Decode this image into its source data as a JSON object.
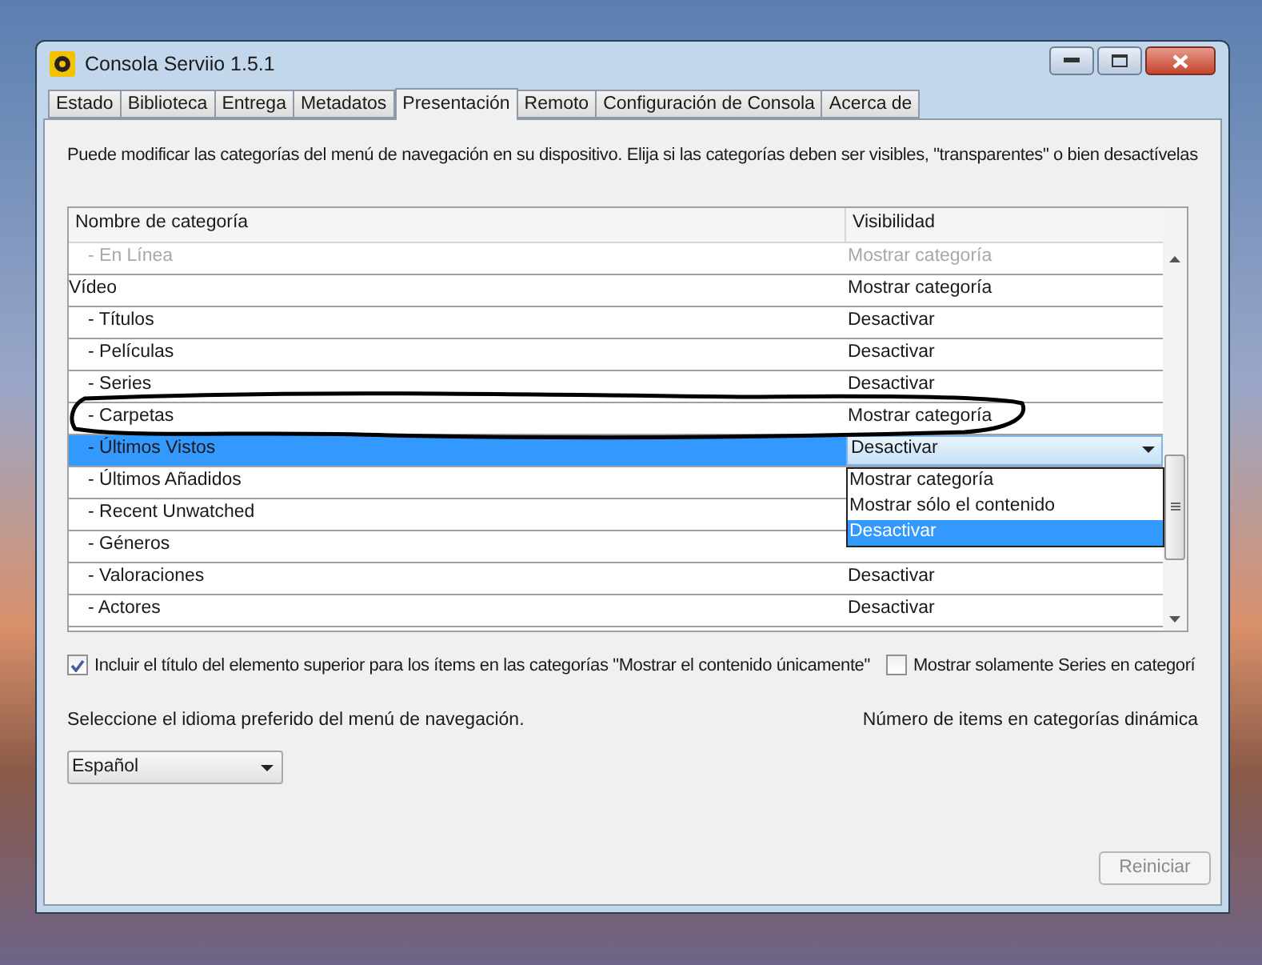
{
  "window": {
    "title": "Consola Serviio 1.5.1"
  },
  "tabs": [
    {
      "label": "Estado",
      "selected": false
    },
    {
      "label": "Biblioteca",
      "selected": false
    },
    {
      "label": "Entrega",
      "selected": false
    },
    {
      "label": "Metadatos",
      "selected": false
    },
    {
      "label": "Presentación",
      "selected": true
    },
    {
      "label": "Remoto",
      "selected": false
    },
    {
      "label": "Configuración de Consola",
      "selected": false
    },
    {
      "label": "Acerca de",
      "selected": false
    }
  ],
  "intro": "Puede modificar las categorías del menú de navegación en su dispositivo. Elija si las categorías deben ser visibles, \"transparentes\" o bien desactívelas",
  "table": {
    "columns": [
      "Nombre de categoría",
      "Visibilidad"
    ],
    "rows": [
      {
        "kind": "entry",
        "name": "- En Línea",
        "visibility": "Mostrar categoría",
        "disabled": true,
        "selected": false
      },
      {
        "kind": "group",
        "name": "Vídeo",
        "visibility": "Mostrar categoría",
        "disabled": false,
        "selected": false
      },
      {
        "kind": "entry",
        "name": "- Títulos",
        "visibility": "Desactivar",
        "disabled": false,
        "selected": false
      },
      {
        "kind": "entry",
        "name": "- Películas",
        "visibility": "Desactivar",
        "disabled": false,
        "selected": false
      },
      {
        "kind": "entry",
        "name": "- Series",
        "visibility": "Desactivar",
        "disabled": false,
        "selected": false
      },
      {
        "kind": "entry",
        "name": "- Carpetas",
        "visibility": "Mostrar categoría",
        "disabled": false,
        "selected": false,
        "circled": true
      },
      {
        "kind": "entry",
        "name": "- Últimos Vistos",
        "visibility": "Desactivar",
        "disabled": false,
        "selected": true,
        "dropdown": {
          "options": [
            {
              "label": "Mostrar categoría",
              "selected": false
            },
            {
              "label": "Mostrar sólo el contenido",
              "selected": false
            },
            {
              "label": "Desactivar",
              "selected": true
            }
          ]
        }
      },
      {
        "kind": "entry",
        "name": "- Últimos Añadidos",
        "disabled": false,
        "selected": false
      },
      {
        "kind": "entry",
        "name": "- Recent Unwatched",
        "disabled": false,
        "selected": false
      },
      {
        "kind": "entry",
        "name": "- Géneros",
        "disabled": false,
        "selected": false
      },
      {
        "kind": "entry",
        "name": "- Valoraciones",
        "visibility": "Desactivar",
        "disabled": false,
        "selected": false
      },
      {
        "kind": "entry",
        "name": "- Actores",
        "visibility": "Desactivar",
        "disabled": false,
        "selected": false
      }
    ]
  },
  "options": [
    {
      "label": "Incluir el título del elemento superior para los ítems en las categorías \"Mostrar el contenido únicamente\"",
      "checked": true
    },
    {
      "label": "Mostrar solamente Series en categorí",
      "checked": false
    }
  ],
  "language": {
    "label": "Seleccione el idioma preferido del menú de navegación.",
    "value": "Español"
  },
  "dynamic_items": {
    "label": "Número de items en categorías dinámica"
  },
  "reset_button": {
    "label": "Reiniciar",
    "disabled": true
  }
}
